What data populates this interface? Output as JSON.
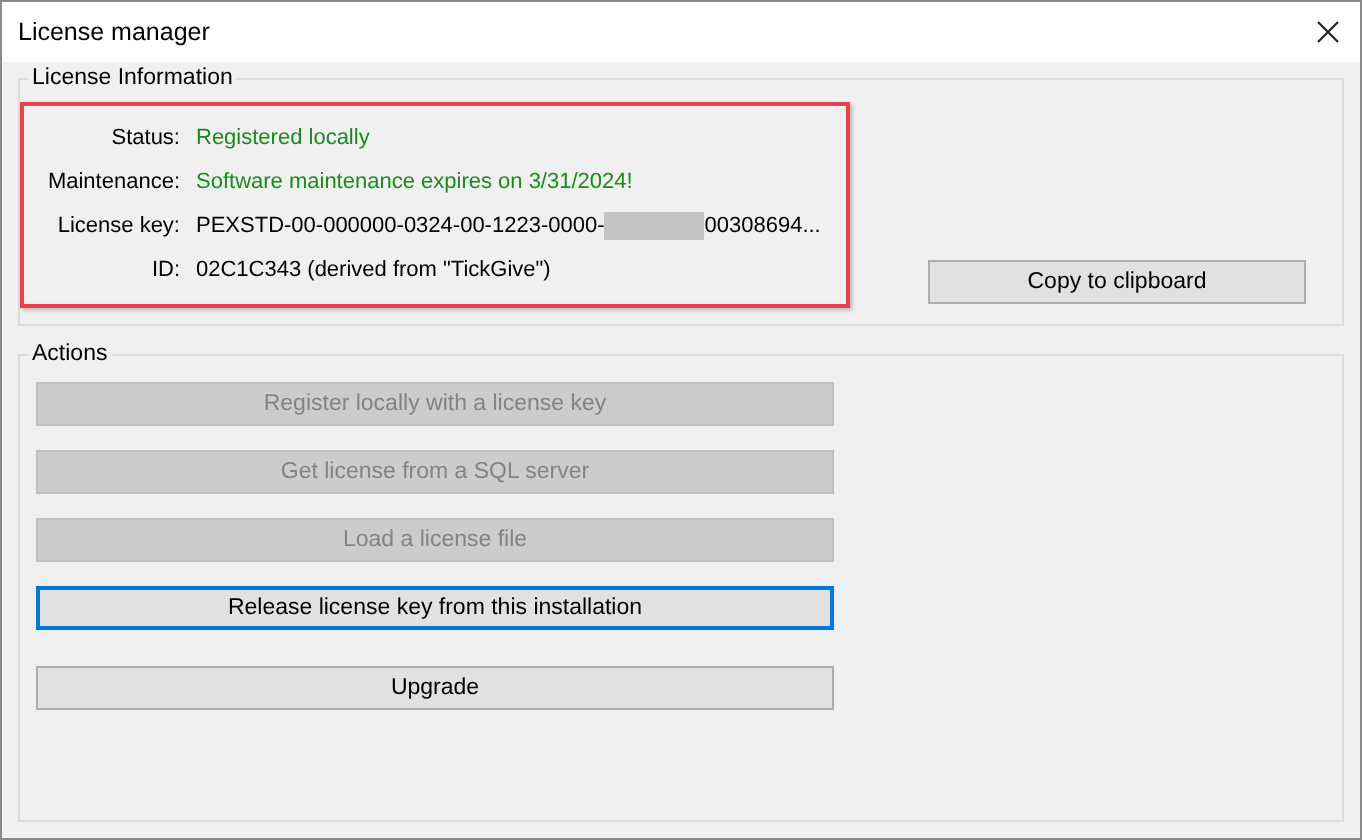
{
  "window": {
    "title": "License manager"
  },
  "license_information": {
    "title": "License Information",
    "highlighted": true,
    "fields": [
      {
        "label": "Status:",
        "kind": "ok",
        "value": "Registered locally"
      },
      {
        "label": "Maintenance:",
        "kind": "ok",
        "value": "Software maintenance expires on 3/31/2024!"
      },
      {
        "label": "License key:",
        "kind": "redacted",
        "value": "PEXSTD-00-000000-0324-00-1223-0000-",
        "value_end": "00308694..."
      },
      {
        "label": "ID:",
        "kind": "plain",
        "value": "02C1C343 (derived from \"TickGive\")"
      }
    ],
    "copy_button": "Copy to clipboard"
  },
  "actions": {
    "title": "Actions",
    "buttons": [
      {
        "label": "Register locally with a license key",
        "disabled": true,
        "focused": false
      },
      {
        "label": "Get license from a SQL server",
        "disabled": true,
        "focused": false
      },
      {
        "label": "Load a license file",
        "disabled": true,
        "focused": false
      },
      {
        "label": "Release license key from this installation",
        "disabled": false,
        "focused": true
      }
    ],
    "lower_buttons": [
      {
        "label": "Upgrade",
        "disabled": false,
        "focused": false
      }
    ]
  }
}
